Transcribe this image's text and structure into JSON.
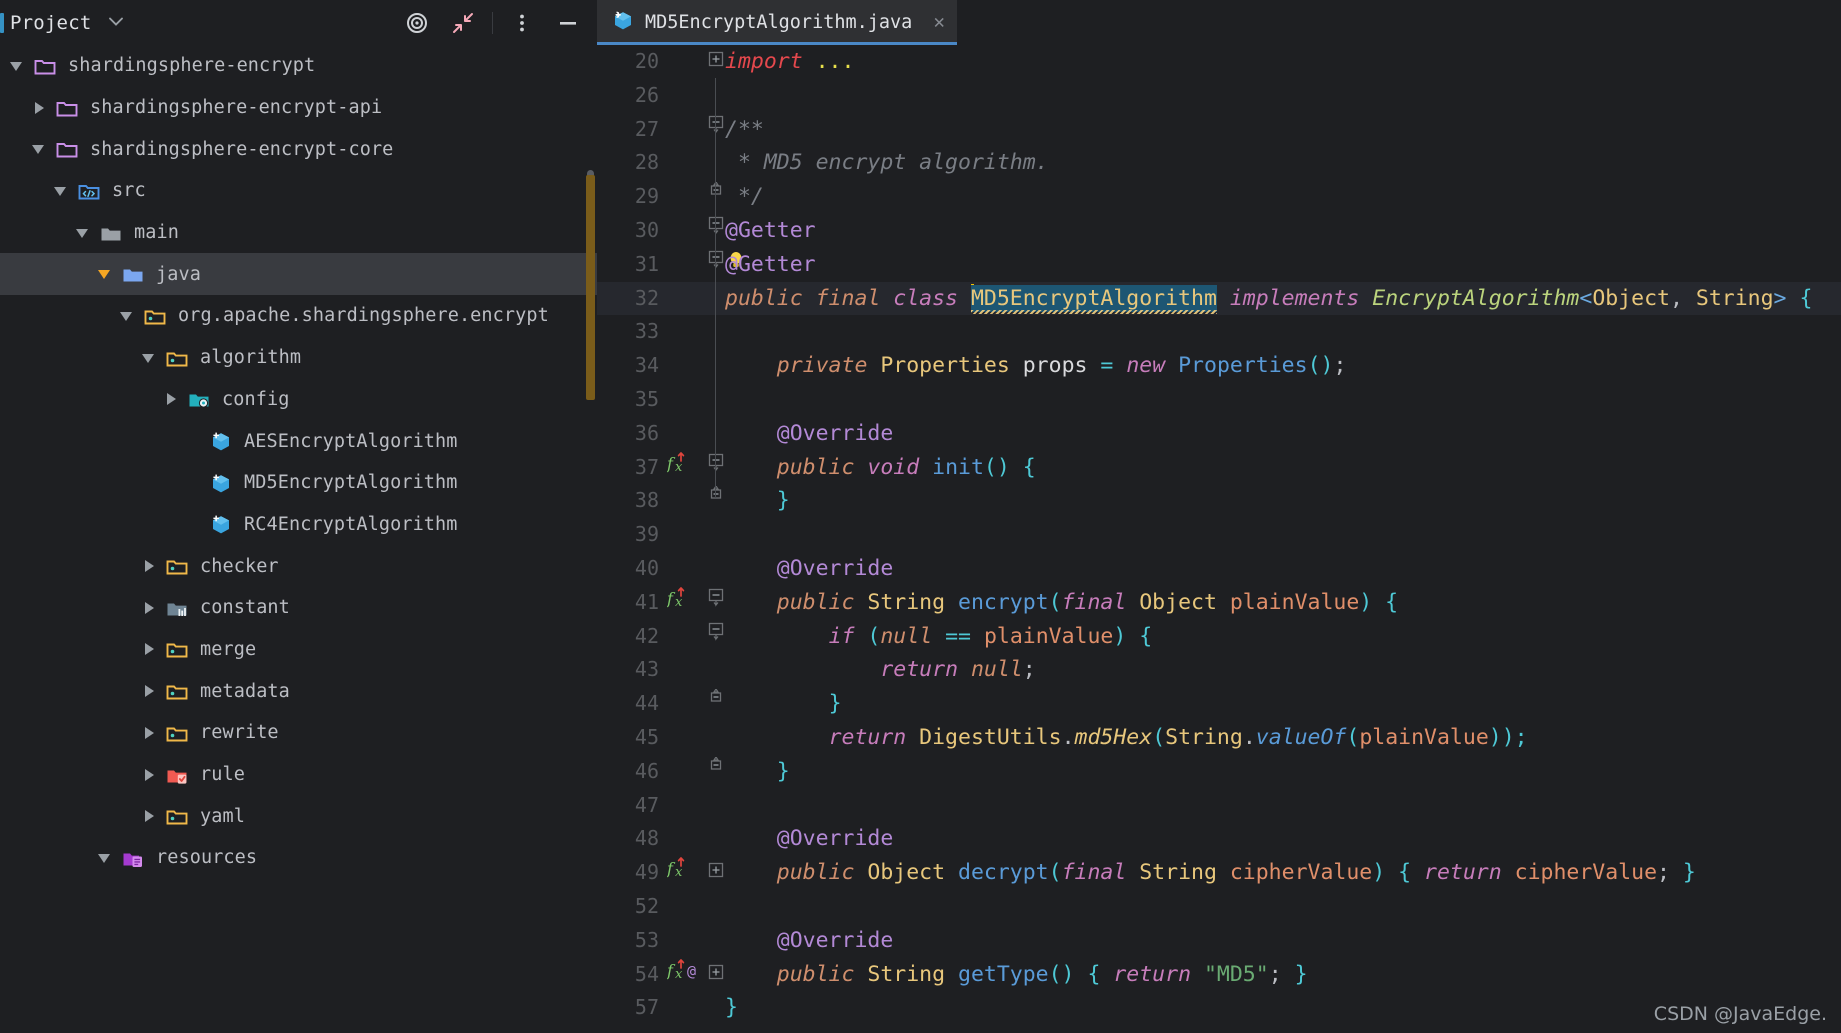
{
  "window": {
    "theme_bg": "#1e1f22",
    "accent": "#3592c4"
  },
  "sidebar": {
    "title": "Project",
    "chevron_icon": "chevron-down-icon",
    "toolbar": [
      {
        "name": "target-locate-icon",
        "label": "◎"
      },
      {
        "name": "collapse-all-icon",
        "label": "↖"
      },
      {
        "name": "more-options-icon",
        "label": "⋮"
      },
      {
        "name": "hide-panel-icon",
        "label": "—"
      }
    ],
    "tree": [
      {
        "label": "shardingsphere-encrypt",
        "indent": 0,
        "arrow": "down",
        "icon": "module-folder-icon",
        "selected": false
      },
      {
        "label": "shardingsphere-encrypt-api",
        "indent": 1,
        "arrow": "right",
        "icon": "module-folder-icon",
        "selected": false
      },
      {
        "label": "shardingsphere-encrypt-core",
        "indent": 1,
        "arrow": "down",
        "icon": "module-folder-icon",
        "selected": false
      },
      {
        "label": "src",
        "indent": 2,
        "arrow": "down",
        "icon": "source-root-icon",
        "selected": false
      },
      {
        "label": "main",
        "indent": 3,
        "arrow": "down",
        "icon": "folder-gray-icon",
        "selected": false
      },
      {
        "label": "java",
        "indent": 4,
        "arrow": "down-orange",
        "icon": "folder-blue-icon",
        "selected": true
      },
      {
        "label": "org.apache.shardingsphere.encrypt",
        "indent": 5,
        "arrow": "down",
        "icon": "package-icon",
        "selected": false
      },
      {
        "label": "algorithm",
        "indent": 6,
        "arrow": "down",
        "icon": "package-icon",
        "selected": false
      },
      {
        "label": "config",
        "indent": 7,
        "arrow": "right",
        "icon": "config-folder-icon",
        "selected": false
      },
      {
        "label": "AESEncryptAlgorithm",
        "indent": 8,
        "arrow": "none",
        "icon": "java-class-icon",
        "selected": false
      },
      {
        "label": "MD5EncryptAlgorithm",
        "indent": 8,
        "arrow": "none",
        "icon": "java-class-icon",
        "selected": false
      },
      {
        "label": "RC4EncryptAlgorithm",
        "indent": 8,
        "arrow": "none",
        "icon": "java-class-icon",
        "selected": false
      },
      {
        "label": "checker",
        "indent": 6,
        "arrow": "right",
        "icon": "package-icon",
        "selected": false
      },
      {
        "label": "constant",
        "indent": 6,
        "arrow": "right",
        "icon": "constant-folder-icon",
        "selected": false
      },
      {
        "label": "merge",
        "indent": 6,
        "arrow": "right",
        "icon": "package-icon",
        "selected": false
      },
      {
        "label": "metadata",
        "indent": 6,
        "arrow": "right",
        "icon": "package-icon",
        "selected": false
      },
      {
        "label": "rewrite",
        "indent": 6,
        "arrow": "right",
        "icon": "package-icon",
        "selected": false
      },
      {
        "label": "rule",
        "indent": 6,
        "arrow": "right",
        "icon": "rule-folder-icon",
        "selected": false
      },
      {
        "label": "yaml",
        "indent": 6,
        "arrow": "right",
        "icon": "package-icon",
        "selected": false
      },
      {
        "label": "resources",
        "indent": 4,
        "arrow": "down",
        "icon": "resources-root-icon",
        "selected": false
      }
    ]
  },
  "editor": {
    "tab": {
      "label": "MD5EncryptAlgorithm.java",
      "icon": "java-class-icon",
      "close_icon": "close-icon",
      "active": true
    },
    "current_line": 32,
    "lines": [
      {
        "num": "20",
        "fold": "+",
        "gutter": "",
        "current": false,
        "tokens": [
          {
            "t": "import ",
            "c": "imp"
          },
          {
            "t": "...",
            "c": "dots"
          }
        ]
      },
      {
        "num": "26",
        "fold": "",
        "gutter": "",
        "current": false,
        "tokens": []
      },
      {
        "num": "27",
        "fold": "-",
        "gutter": "",
        "current": false,
        "tokens": [
          {
            "t": "/**",
            "c": "cmt"
          }
        ]
      },
      {
        "num": "28",
        "fold": "",
        "gutter": "",
        "current": false,
        "tokens": [
          {
            "t": " * MD5 encrypt algorithm.",
            "c": "cmt"
          }
        ]
      },
      {
        "num": "29",
        "fold": "^",
        "gutter": "",
        "current": false,
        "tokens": [
          {
            "t": " */",
            "c": "cmt"
          }
        ]
      },
      {
        "num": "30",
        "fold": "-",
        "gutter": "",
        "current": false,
        "tokens": [
          {
            "t": "@Getter",
            "c": "anno"
          }
        ]
      },
      {
        "num": "31",
        "fold": "-",
        "gutter": "bulb",
        "current": false,
        "tokens": [
          {
            "t": "@Getter",
            "c": "anno"
          }
        ]
      },
      {
        "num": "32",
        "fold": "",
        "gutter": "",
        "current": true,
        "tokens": [
          {
            "t": "public ",
            "c": "kw"
          },
          {
            "t": "final ",
            "c": "kw"
          },
          {
            "t": "class ",
            "c": "cls"
          },
          {
            "t": "MD5EncryptAlgorithm",
            "c": "hl-class"
          },
          {
            "t": " ",
            "c": "white"
          },
          {
            "t": "implements ",
            "c": "kw2"
          },
          {
            "t": "EncryptAlgorithm",
            "c": "type-g"
          },
          {
            "t": "<",
            "c": "angle"
          },
          {
            "t": "Object",
            "c": "type"
          },
          {
            "t": ", ",
            "c": "white"
          },
          {
            "t": "String",
            "c": "type"
          },
          {
            "t": ">",
            "c": "angle"
          },
          {
            "t": " ",
            "c": "white"
          },
          {
            "t": "{",
            "c": "punct"
          }
        ]
      },
      {
        "num": "33",
        "fold": "",
        "gutter": "",
        "current": false,
        "tokens": []
      },
      {
        "num": "34",
        "fold": "",
        "gutter": "",
        "current": false,
        "tokens": [
          {
            "t": "    ",
            "c": "white"
          },
          {
            "t": "private ",
            "c": "kw"
          },
          {
            "t": "Properties ",
            "c": "type"
          },
          {
            "t": "props",
            "c": "fld"
          },
          {
            "t": " ",
            "c": "white"
          },
          {
            "t": "=",
            "c": "punct"
          },
          {
            "t": " ",
            "c": "white"
          },
          {
            "t": "new ",
            "c": "kw2"
          },
          {
            "t": "Properties",
            "c": "meth"
          },
          {
            "t": "()",
            "c": "punct"
          },
          {
            "t": ";",
            "c": "white"
          }
        ]
      },
      {
        "num": "35",
        "fold": "",
        "gutter": "",
        "current": false,
        "tokens": []
      },
      {
        "num": "36",
        "fold": "",
        "gutter": "",
        "current": false,
        "tokens": [
          {
            "t": "    ",
            "c": "white"
          },
          {
            "t": "@Override",
            "c": "anno"
          }
        ]
      },
      {
        "num": "37",
        "fold": "-",
        "gutter": "fx",
        "current": false,
        "tokens": [
          {
            "t": "    ",
            "c": "white"
          },
          {
            "t": "public ",
            "c": "kw"
          },
          {
            "t": "void ",
            "c": "kw2"
          },
          {
            "t": "init",
            "c": "meth"
          },
          {
            "t": "() {",
            "c": "punct"
          }
        ]
      },
      {
        "num": "38",
        "fold": "^",
        "gutter": "",
        "current": false,
        "tokens": [
          {
            "t": "    ",
            "c": "white"
          },
          {
            "t": "}",
            "c": "punct"
          }
        ]
      },
      {
        "num": "39",
        "fold": "",
        "gutter": "",
        "current": false,
        "tokens": []
      },
      {
        "num": "40",
        "fold": "",
        "gutter": "",
        "current": false,
        "tokens": [
          {
            "t": "    ",
            "c": "white"
          },
          {
            "t": "@Override",
            "c": "anno"
          }
        ]
      },
      {
        "num": "41",
        "fold": "-",
        "gutter": "fx",
        "current": false,
        "tokens": [
          {
            "t": "    ",
            "c": "white"
          },
          {
            "t": "public ",
            "c": "kw"
          },
          {
            "t": "String ",
            "c": "type"
          },
          {
            "t": "encrypt",
            "c": "meth"
          },
          {
            "t": "(",
            "c": "punct"
          },
          {
            "t": "final ",
            "c": "kw2"
          },
          {
            "t": "Object ",
            "c": "type"
          },
          {
            "t": "plainValue",
            "c": "param"
          },
          {
            "t": ") {",
            "c": "punct"
          }
        ]
      },
      {
        "num": "42",
        "fold": "-",
        "gutter": "",
        "current": false,
        "tokens": [
          {
            "t": "        ",
            "c": "white"
          },
          {
            "t": "if ",
            "c": "kw2"
          },
          {
            "t": "(",
            "c": "punct"
          },
          {
            "t": "null",
            "c": "kw"
          },
          {
            "t": " ",
            "c": "white"
          },
          {
            "t": "==",
            "c": "punct"
          },
          {
            "t": " ",
            "c": "white"
          },
          {
            "t": "plainValue",
            "c": "param"
          },
          {
            "t": ") {",
            "c": "punct"
          }
        ]
      },
      {
        "num": "43",
        "fold": "",
        "gutter": "",
        "current": false,
        "tokens": [
          {
            "t": "            ",
            "c": "white"
          },
          {
            "t": "return ",
            "c": "kw2"
          },
          {
            "t": "null",
            "c": "kw"
          },
          {
            "t": ";",
            "c": "white"
          }
        ]
      },
      {
        "num": "44",
        "fold": "^",
        "gutter": "",
        "current": false,
        "tokens": [
          {
            "t": "        ",
            "c": "white"
          },
          {
            "t": "}",
            "c": "punct"
          }
        ]
      },
      {
        "num": "45",
        "fold": "",
        "gutter": "",
        "current": false,
        "tokens": [
          {
            "t": "        ",
            "c": "white"
          },
          {
            "t": "return ",
            "c": "kw2"
          },
          {
            "t": "DigestUtils",
            "c": "type"
          },
          {
            "t": ".",
            "c": "white"
          },
          {
            "t": "md5Hex",
            "c": "meth-s"
          },
          {
            "t": "(",
            "c": "punct"
          },
          {
            "t": "String",
            "c": "type"
          },
          {
            "t": ".",
            "c": "white"
          },
          {
            "t": "valueOf",
            "c": "meth-si"
          },
          {
            "t": "(",
            "c": "punct"
          },
          {
            "t": "plainValue",
            "c": "param"
          },
          {
            "t": "));",
            "c": "punct"
          }
        ]
      },
      {
        "num": "46",
        "fold": "^",
        "gutter": "",
        "current": false,
        "tokens": [
          {
            "t": "    ",
            "c": "white"
          },
          {
            "t": "}",
            "c": "punct"
          }
        ]
      },
      {
        "num": "47",
        "fold": "",
        "gutter": "",
        "current": false,
        "tokens": []
      },
      {
        "num": "48",
        "fold": "",
        "gutter": "",
        "current": false,
        "tokens": [
          {
            "t": "    ",
            "c": "white"
          },
          {
            "t": "@Override",
            "c": "anno"
          }
        ]
      },
      {
        "num": "49",
        "fold": "+",
        "gutter": "fx",
        "current": false,
        "tokens": [
          {
            "t": "    ",
            "c": "white"
          },
          {
            "t": "public ",
            "c": "kw"
          },
          {
            "t": "Object ",
            "c": "type"
          },
          {
            "t": "decrypt",
            "c": "meth"
          },
          {
            "t": "(",
            "c": "punct"
          },
          {
            "t": "final ",
            "c": "kw2"
          },
          {
            "t": "String ",
            "c": "type"
          },
          {
            "t": "cipherValue",
            "c": "param"
          },
          {
            "t": ") { ",
            "c": "punct"
          },
          {
            "t": "return ",
            "c": "kw2"
          },
          {
            "t": "cipherValue",
            "c": "param"
          },
          {
            "t": "; ",
            "c": "white"
          },
          {
            "t": "}",
            "c": "punct"
          }
        ]
      },
      {
        "num": "52",
        "fold": "",
        "gutter": "",
        "current": false,
        "tokens": []
      },
      {
        "num": "53",
        "fold": "",
        "gutter": "",
        "current": false,
        "tokens": [
          {
            "t": "    ",
            "c": "white"
          },
          {
            "t": "@Override",
            "c": "anno"
          }
        ]
      },
      {
        "num": "54",
        "fold": "+",
        "gutter": "fx-at",
        "current": false,
        "tokens": [
          {
            "t": "    ",
            "c": "white"
          },
          {
            "t": "public ",
            "c": "kw"
          },
          {
            "t": "String ",
            "c": "type"
          },
          {
            "t": "getType",
            "c": "meth"
          },
          {
            "t": "() { ",
            "c": "punct"
          },
          {
            "t": "return ",
            "c": "kw2"
          },
          {
            "t": "\"MD5\"",
            "c": "str"
          },
          {
            "t": "; ",
            "c": "white"
          },
          {
            "t": "}",
            "c": "punct"
          }
        ]
      },
      {
        "num": "57",
        "fold": "",
        "gutter": "",
        "current": false,
        "tokens": [
          {
            "t": "}",
            "c": "punct"
          }
        ]
      }
    ]
  },
  "watermark": {
    "text": "CSDN @JavaEdge."
  }
}
